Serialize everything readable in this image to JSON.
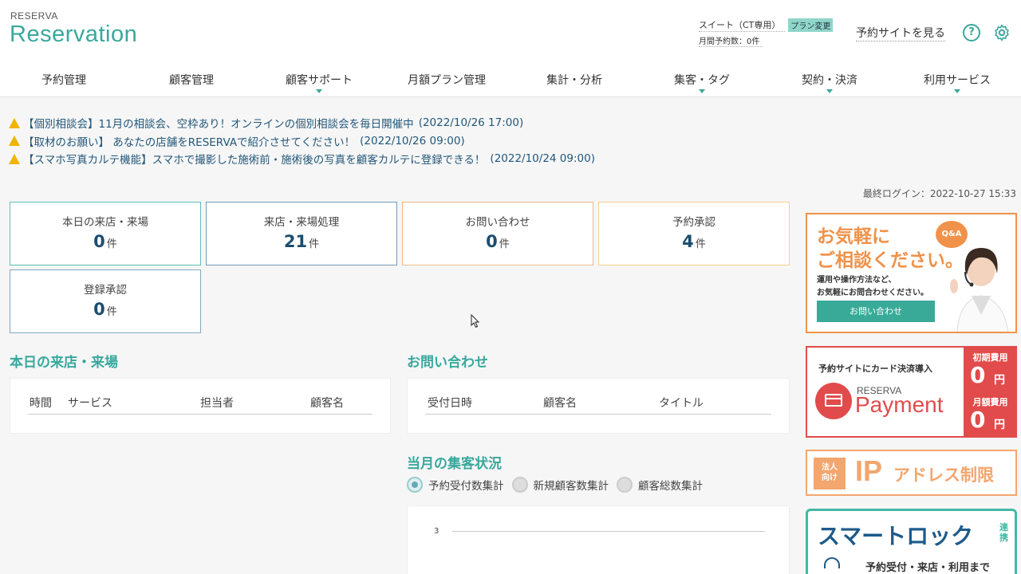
{
  "header": {
    "logo_small": "RESERVA",
    "logo_main": "Reservation",
    "plan_name": "スイート（CT専用）",
    "plan_change": "プラン変更",
    "monthly_count": "月間予約数：0件",
    "site_link": "予約サイトを見る",
    "help_icon": "?"
  },
  "nav": [
    {
      "label": "予約管理",
      "has_menu": false
    },
    {
      "label": "顧客管理",
      "has_menu": false
    },
    {
      "label": "顧客サポート",
      "has_menu": true
    },
    {
      "label": "月額プラン管理",
      "has_menu": false
    },
    {
      "label": "集計・分析",
      "has_menu": false
    },
    {
      "label": "集客・タグ",
      "has_menu": true
    },
    {
      "label": "契約・決済",
      "has_menu": true
    },
    {
      "label": "利用サービス",
      "has_menu": true
    }
  ],
  "notices": [
    {
      "text": "【個別相談会】11月の相談会、空枠あり！オンラインの個別相談会を毎日開催中",
      "date": "(2022/10/26 17:00)"
    },
    {
      "text": "【取材のお願い】 あなたの店舗をRESERVAで紹介させてください！",
      "date": "(2022/10/26 09:00)"
    },
    {
      "text": "【スマホ写真カルテ機能】スマホで撮影した施術前・施術後の写真を顧客カルテに登録できる！",
      "date": "(2022/10/24 09:00)"
    }
  ],
  "last_login": "最終ログイン：2022-10-27 15:33",
  "tiles": [
    {
      "label": "本日の来店・来場",
      "value": "0",
      "unit": "件",
      "border": "#5bbfb2"
    },
    {
      "label": "来店・来場処理",
      "value": "21",
      "unit": "件",
      "border": "#6f9bbf"
    },
    {
      "label": "お問い合わせ",
      "value": "0",
      "unit": "件",
      "border": "#f0b98a"
    },
    {
      "label": "予約承認",
      "value": "4",
      "unit": "件",
      "border": "#f5cf8a"
    },
    {
      "label": "登録承認",
      "value": "0",
      "unit": "件",
      "border": "#7fa8c4"
    }
  ],
  "today": {
    "title": "本日の来店・来場",
    "columns": [
      "時間",
      "サービス",
      "担当者",
      "顧客名"
    ]
  },
  "inquiry": {
    "title": "お問い合わせ",
    "columns": [
      "受付日時",
      "顧客名",
      "タイトル"
    ]
  },
  "monthly": {
    "title": "当月の集客状況",
    "options": [
      {
        "label": "予約受付数集計",
        "selected": true
      },
      {
        "label": "新規顧客数集計",
        "selected": false
      },
      {
        "label": "顧客総数集計",
        "selected": false
      }
    ],
    "y_tick": "3"
  },
  "ads": {
    "consult": {
      "title_line1": "お気軽に",
      "title_line2": "ご相談ください。",
      "bubble": "Q&A",
      "desc_line1": "運用や操作方法など、",
      "desc_line2": "お気軽にお問合わせください。",
      "button": "お問い合わせ"
    },
    "payment": {
      "intro": "予約サイトにカード決済導入",
      "brand_small": "RESERVA",
      "brand": "Payment",
      "fee1_label": "初期費用",
      "fee1_value": "0",
      "fee2_label": "月額費用",
      "fee2_value": "0",
      "unit": "円"
    },
    "ip": {
      "badge_line1": "法人",
      "badge_line2": "向け",
      "big": "IP",
      "text": "アドレス制限"
    },
    "smartlock": {
      "title": "スマートロック",
      "side": "連携",
      "sub": "予約受付・来店・利用まで"
    }
  },
  "colors": {
    "accent": "#38a89d",
    "navy": "#1c4d6e",
    "orange": "#f0924a",
    "red": "#e24b4b"
  }
}
